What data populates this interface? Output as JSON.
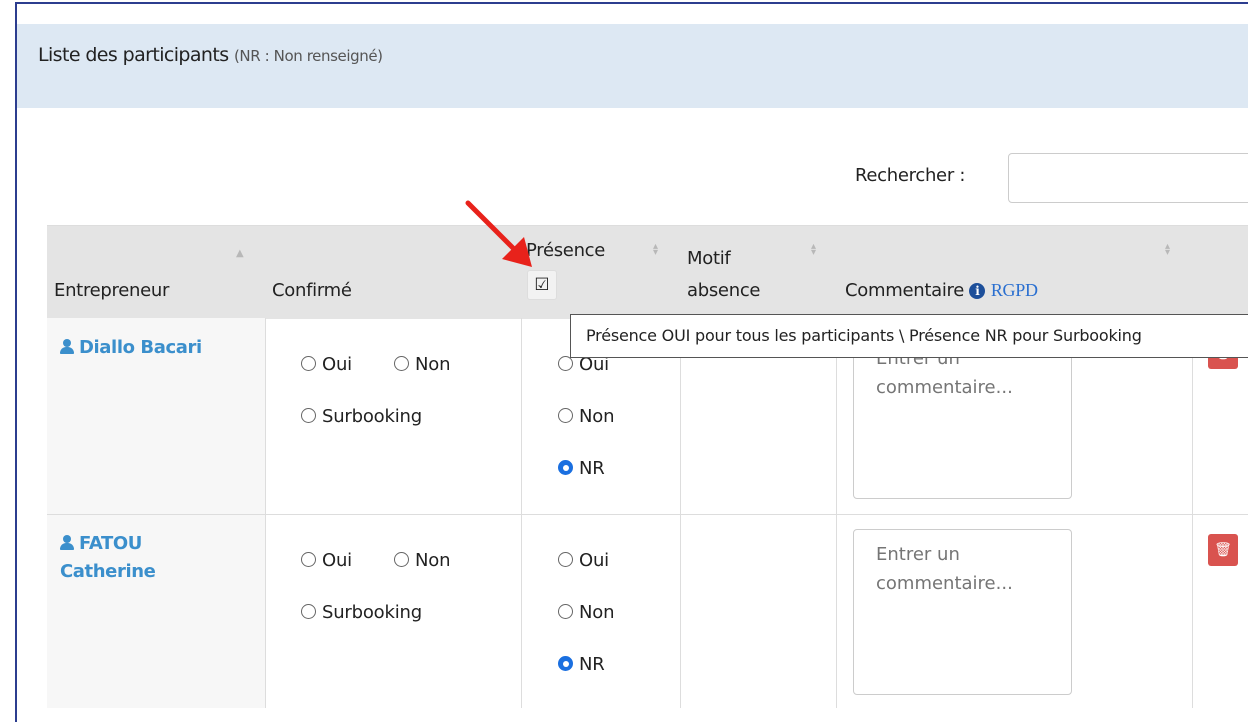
{
  "panel": {
    "title": "Liste des participants",
    "subtitle": "(NR : Non renseigné)"
  },
  "search": {
    "label": "Rechercher :",
    "value": ""
  },
  "columns": {
    "entrepreneur": "Entrepreneur",
    "confirme": "Confirmé",
    "presence": "Présence",
    "motif_line1": "Motif",
    "motif_line2": "absence",
    "commentaire": "Commentaire",
    "rgpd": "RGPD"
  },
  "tooltip": "Présence OUI pour tous les participants \\ Présence NR pour Surbooking",
  "options": {
    "oui": "Oui",
    "non": "Non",
    "surbooking": "Surbooking",
    "nr": "NR"
  },
  "rows": [
    {
      "name_line1": "Diallo Bacari",
      "name_line2": "",
      "confirme": "none",
      "presence": "NR",
      "comment_placeholder": "Entrer un commentaire..."
    },
    {
      "name_line1": "FATOU",
      "name_line2": "Catherine",
      "confirme": "none",
      "presence": "NR",
      "comment_placeholder": "Entrer un commentaire..."
    }
  ],
  "colors": {
    "link": "#3b8fcc",
    "header_bg": "#dde8f3",
    "radio_checked": "#1a6fe0",
    "delete": "#d9534f",
    "arrow": "#e8221b"
  }
}
